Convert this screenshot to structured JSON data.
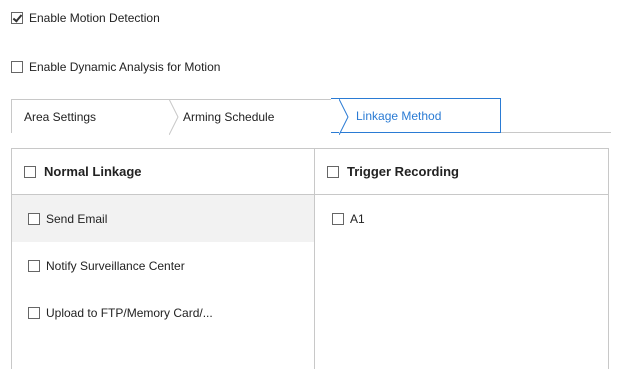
{
  "options": {
    "motion_detection": {
      "label": "Enable Motion Detection",
      "checked": true
    },
    "dynamic_analysis": {
      "label": "Enable Dynamic Analysis for Motion",
      "checked": false
    }
  },
  "tabs": [
    {
      "label": "Area Settings",
      "active": false
    },
    {
      "label": "Arming Schedule",
      "active": false
    },
    {
      "label": "Linkage Method",
      "active": true
    }
  ],
  "linkage": {
    "normal": {
      "header": "Normal Linkage",
      "items": [
        {
          "label": "Send Email",
          "checked": false
        },
        {
          "label": "Notify Surveillance Center",
          "checked": false
        },
        {
          "label": "Upload to FTP/Memory Card/...",
          "checked": false
        }
      ]
    },
    "trigger": {
      "header": "Trigger Recording",
      "items": [
        {
          "label": "A1",
          "checked": false
        }
      ]
    }
  },
  "colors": {
    "accent": "#2a7bd4",
    "border": "#c8c8c8",
    "row_highlight": "#f2f2f2"
  }
}
